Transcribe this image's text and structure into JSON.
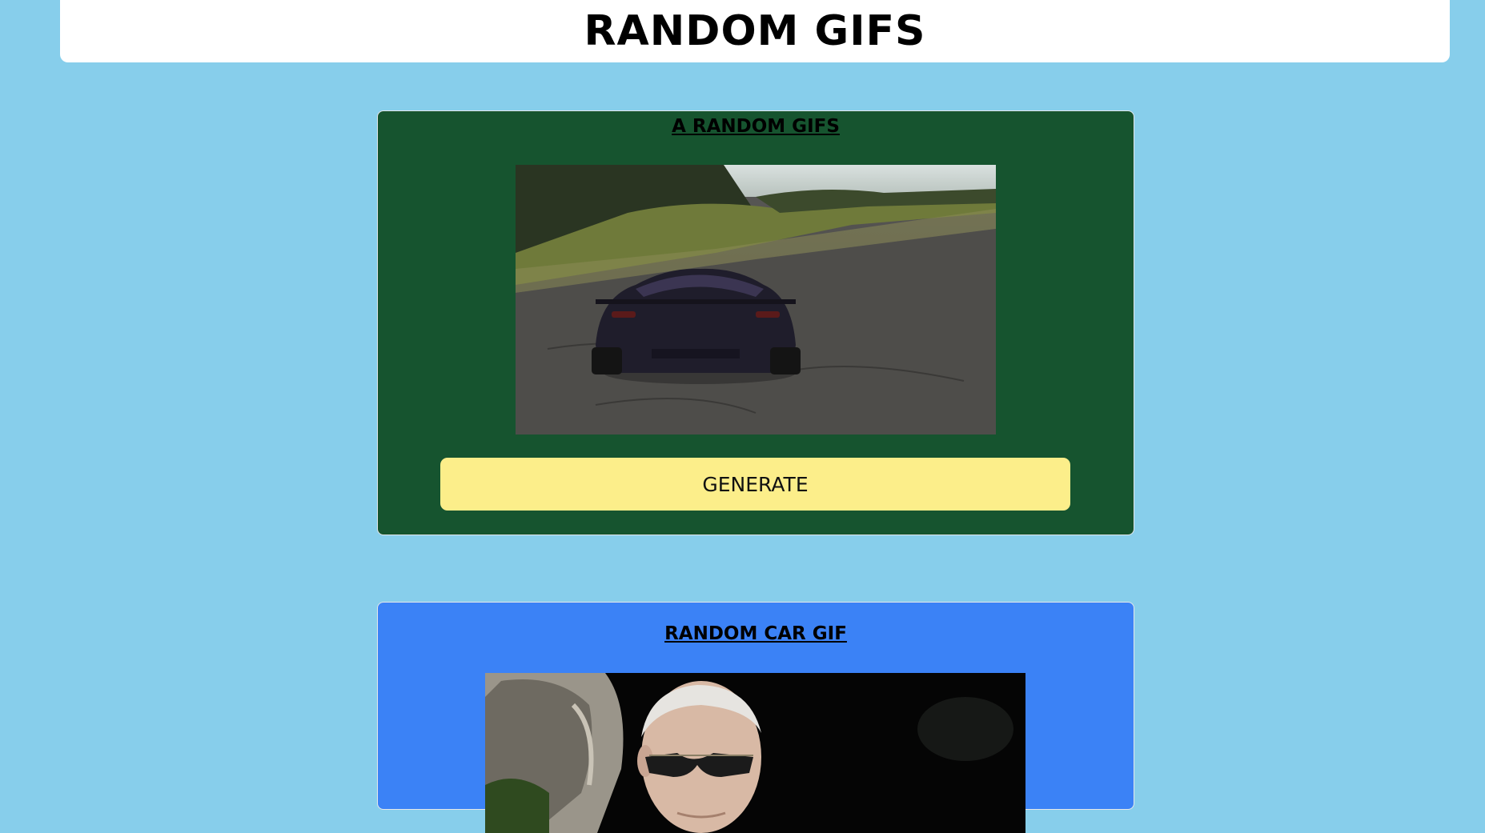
{
  "header": {
    "title": "RANDOM GIFS"
  },
  "random_card": {
    "title": "A RANDOM GIFS",
    "image_alt": "random gif of a sports car driving on a runway",
    "button_label": "GENERATE",
    "background": "#16542f",
    "button_color": "#fcee8a"
  },
  "car_card": {
    "title": "RANDOM CAR GIF",
    "image_alt": "random car gif of a man in sunglasses in a car",
    "background": "#3b82f6"
  },
  "page": {
    "background": "#87CEEB"
  }
}
